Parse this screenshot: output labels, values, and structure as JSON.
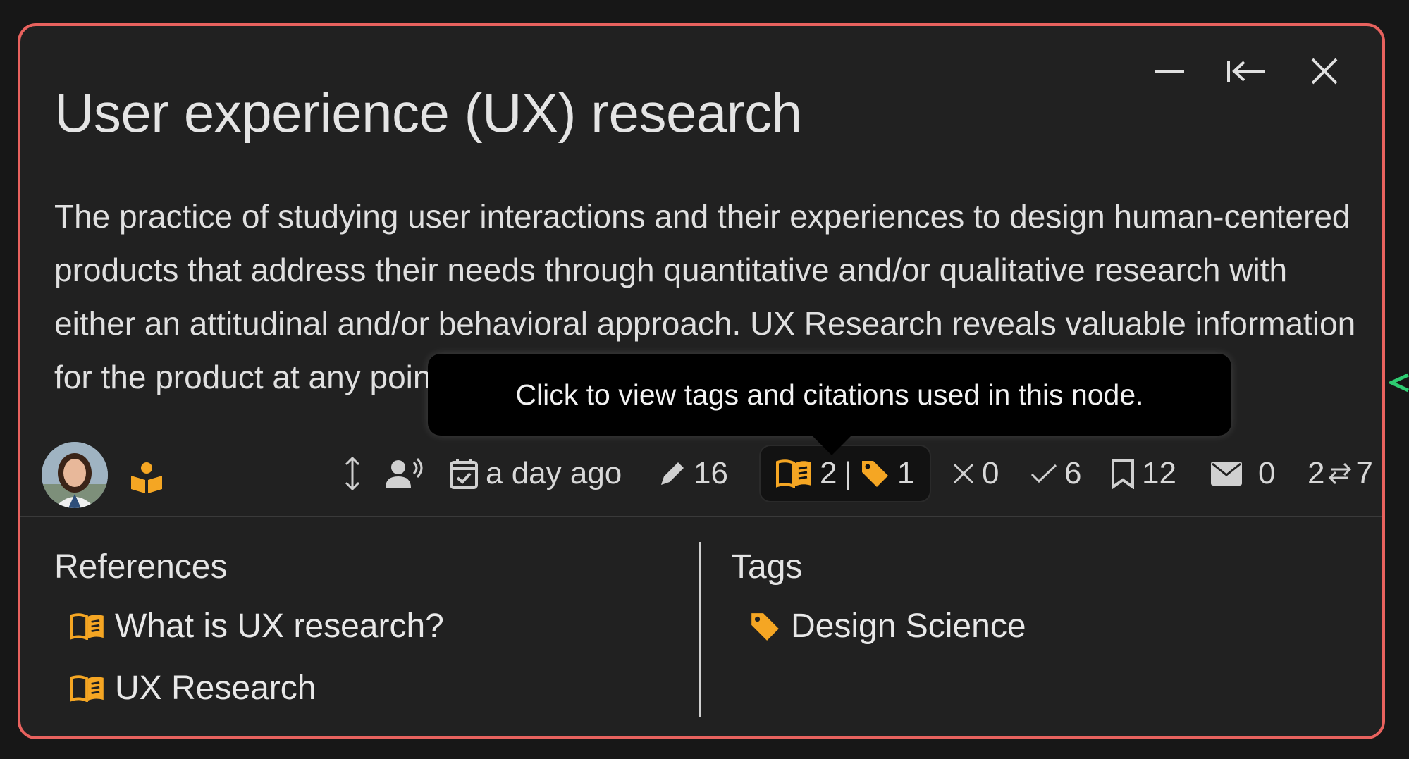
{
  "node": {
    "title": "User experience (UX) research",
    "description": "The practice of studying user interactions and their experiences to design human-centered products that address their needs through quantitative and/or qualitative research with either an attitudinal and/or behavioral approach. UX Research reveals valuable information for the product at any point in an iterative design process."
  },
  "window_controls": {
    "minimize_icon": "minimize-icon",
    "collapse_icon": "collapse-left-icon",
    "close_icon": "close-icon"
  },
  "meta": {
    "updated": "a day ago",
    "edits": "16",
    "references_count": "2",
    "separator": "|",
    "tags_count": "1",
    "wrong_votes": "0",
    "correct_votes": "6",
    "bookmarks": "12",
    "messages": "0",
    "links_in": "2",
    "links_out": "7"
  },
  "tooltip": {
    "text": "Click to view tags and citations used in this node."
  },
  "references": {
    "title": "References",
    "items": [
      {
        "label": "What is UX research?"
      },
      {
        "label": "UX Research"
      }
    ]
  },
  "tags": {
    "title": "Tags",
    "items": [
      {
        "label": "Design Science"
      }
    ]
  },
  "colors": {
    "border": "#e8625e",
    "accent": "#f5a623",
    "background": "#212121",
    "edge_arrow": "#2ecc71"
  }
}
